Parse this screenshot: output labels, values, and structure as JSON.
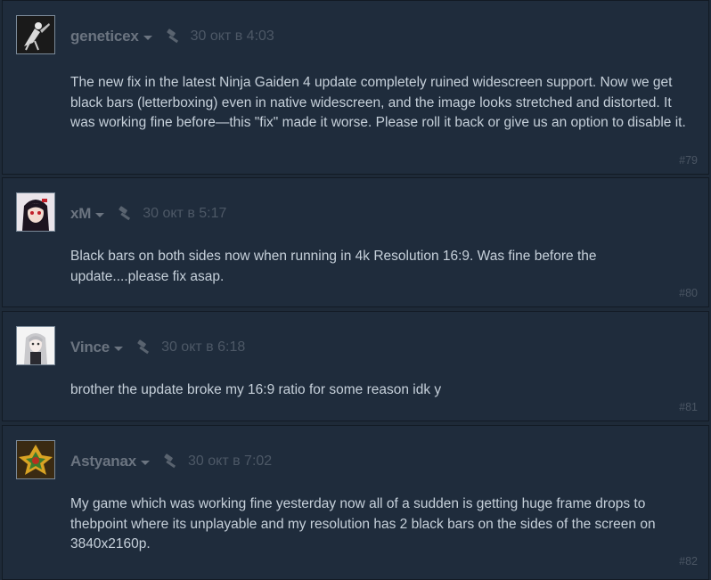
{
  "comments": [
    {
      "username": "geneticex",
      "timestamp": "30 окт в 4:03",
      "text": "The new fix in the latest Ninja Gaiden 4 update completely ruined widescreen support. Now we get black bars (letterboxing) even in native widescreen, and the image looks stretched and distorted. It was working fine before—this \"fix\" made it worse. Please roll it back or give us an option to disable it.",
      "number": "#79"
    },
    {
      "username": "xM",
      "timestamp": "30 окт в 5:17",
      "text": "Black bars on both sides now when running in 4k Resolution 16:9. Was fine before the update....please fix asap.",
      "number": "#80"
    },
    {
      "username": "Vince",
      "timestamp": "30 окт в 6:18",
      "text": "brother the update broke my 16:9 ratio for some reason idk y",
      "number": "#81"
    },
    {
      "username": "Astyanax",
      "timestamp": "30 окт в 7:02",
      "text": "My game which was working fine yesterday now all of a sudden is getting huge frame drops to thebpoint where its unplayable and my resolution has 2 black bars on the sides of the screen on 3840x2160p.",
      "number": "#82"
    }
  ],
  "icons": {
    "dropdown": "chevron-down-icon",
    "moderation": "hammer-icon"
  },
  "colors": {
    "background": "#1b2838",
    "comment_bg": "#1f2c3c",
    "username": "#6b7480",
    "timestamp": "#4d5866",
    "body_text": "#c6d0da",
    "post_number": "#4a5563"
  }
}
